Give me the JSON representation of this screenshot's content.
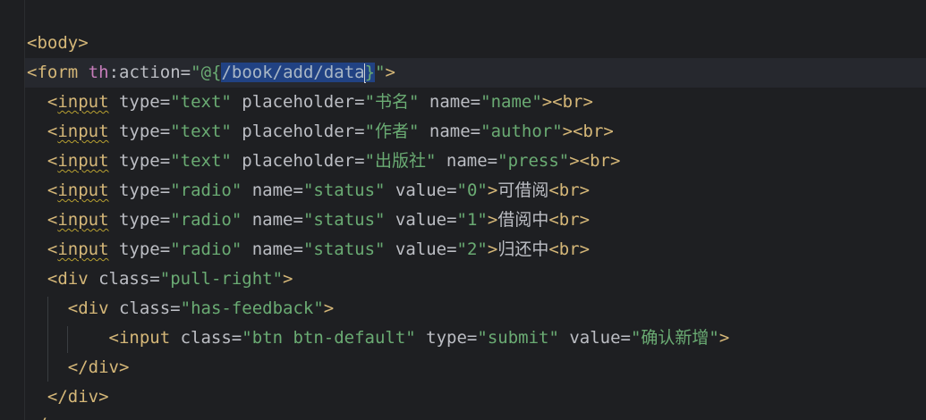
{
  "editor": {
    "lines": {
      "l1": {
        "open": "<",
        "tag": "body",
        "close": ">"
      },
      "l2": {
        "open": "<",
        "tag": "form",
        "sp": " ",
        "ns": "th",
        "colon": ":",
        "attr": "action",
        "eq": "=",
        "q1": "\"",
        "at": "@{",
        "selected": "/book/add/data",
        "brace": "}",
        "q2": "\"",
        "close": ">"
      },
      "l3": {
        "indent": "  ",
        "open": "<",
        "tag": "input",
        "a1": " type",
        "eq1": "=",
        "v1": "\"text\"",
        "a2": " placeholder",
        "eq2": "=",
        "v2": "\"书名\"",
        "a3": " name",
        "eq3": "=",
        "v3": "\"name\"",
        "tail": "><br>"
      },
      "l4": {
        "indent": "  ",
        "open": "<",
        "tag": "input",
        "a1": " type",
        "eq1": "=",
        "v1": "\"text\"",
        "a2": " placeholder",
        "eq2": "=",
        "v2": "\"作者\"",
        "a3": " name",
        "eq3": "=",
        "v3": "\"author\"",
        "tail": "><br>"
      },
      "l5": {
        "indent": "  ",
        "open": "<",
        "tag": "input",
        "a1": " type",
        "eq1": "=",
        "v1": "\"text\"",
        "a2": " placeholder",
        "eq2": "=",
        "v2": "\"出版社\"",
        "a3": " name",
        "eq3": "=",
        "v3": "\"press\"",
        "tail": "><br>"
      },
      "l6": {
        "indent": "  ",
        "open": "<",
        "tag": "input",
        "a1": " type",
        "eq1": "=",
        "v1": "\"radio\"",
        "a2": " name",
        "eq2": "=",
        "v2": "\"status\"",
        "a3": " value",
        "eq3": "=",
        "v3": "\"0\"",
        "gt": ">",
        "text": "可借阅",
        "br": "<br>"
      },
      "l7": {
        "indent": "  ",
        "open": "<",
        "tag": "input",
        "a1": " type",
        "eq1": "=",
        "v1": "\"radio\"",
        "a2": " name",
        "eq2": "=",
        "v2": "\"status\"",
        "a3": " value",
        "eq3": "=",
        "v3": "\"1\"",
        "gt": ">",
        "text": "借阅中",
        "br": "<br>"
      },
      "l8": {
        "indent": "  ",
        "open": "<",
        "tag": "input",
        "a1": " type",
        "eq1": "=",
        "v1": "\"radio\"",
        "a2": " name",
        "eq2": "=",
        "v2": "\"status\"",
        "a3": " value",
        "eq3": "=",
        "v3": "\"2\"",
        "gt": ">",
        "text": "归还中",
        "br": "<br>"
      },
      "l9": {
        "indent": "  ",
        "open": "<div",
        "a1": " class",
        "eq1": "=",
        "v1": "\"pull-right\"",
        "close": ">"
      },
      "l10": {
        "indent": "    ",
        "open": "<div",
        "a1": " class",
        "eq1": "=",
        "v1": "\"has-feedback\"",
        "close": ">"
      },
      "l11": {
        "indent": "        ",
        "open": "<input",
        "a1": " class",
        "eq1": "=",
        "v1": "\"btn btn-default\"",
        "a2": " type",
        "eq2": "=",
        "v2": "\"submit\"",
        "a3": " value",
        "eq3": "=",
        "v3": "\"确认新增\"",
        "close": ">"
      },
      "l12": {
        "indent": "    ",
        "tag": "</div>"
      },
      "l13": {
        "indent": "  ",
        "tag": "</div>"
      },
      "l14": {
        "indent": "",
        "tag": "</"
      }
    }
  }
}
